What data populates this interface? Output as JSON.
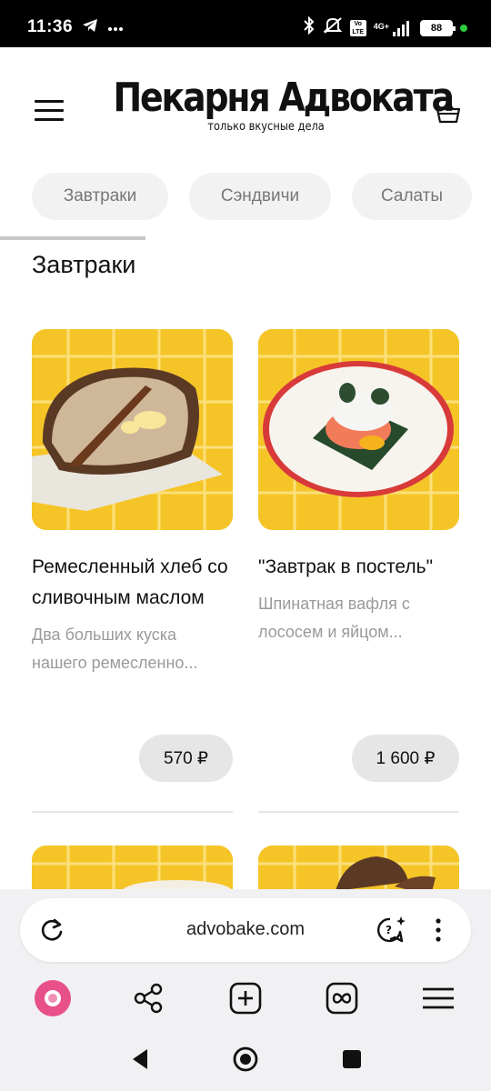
{
  "status_bar": {
    "time": "11:36",
    "left_icons": [
      "telegram-icon",
      "more-dots-icon"
    ],
    "right_icons": [
      "bluetooth-icon",
      "mute-icon",
      "volte-icon",
      "signal-4g-icon"
    ],
    "network_label": "4G+",
    "volte_label": "Vo LTE",
    "battery_level": "88"
  },
  "header": {
    "logo_title": "Пекарня Адвоката",
    "logo_subtitle": "только вкусные дела"
  },
  "categories": [
    {
      "label": "Завтраки"
    },
    {
      "label": "Сэндвичи"
    },
    {
      "label": "Салаты"
    }
  ],
  "section": {
    "title": "Завтраки"
  },
  "products": [
    {
      "name": "Ремесленный хлеб со сливочным маслом",
      "description": "Два больших куска нашего ремесленно...",
      "price": "570 ₽"
    },
    {
      "name": "\"Завтрак в постель\"",
      "description": "Шпинатная вафля с лососем и яйцом...",
      "price": "1 600 ₽"
    }
  ],
  "browser": {
    "url": "advobake.com",
    "toolbar_icons": [
      "alice-icon",
      "share-icon",
      "new-tab-icon",
      "tabs-icon",
      "menu-icon"
    ]
  },
  "colors": {
    "tile_yellow": "#f5c528",
    "pill_bg": "#f2f2f2",
    "price_bg": "#e6e6e6",
    "alice_pink": "#e8508a"
  }
}
